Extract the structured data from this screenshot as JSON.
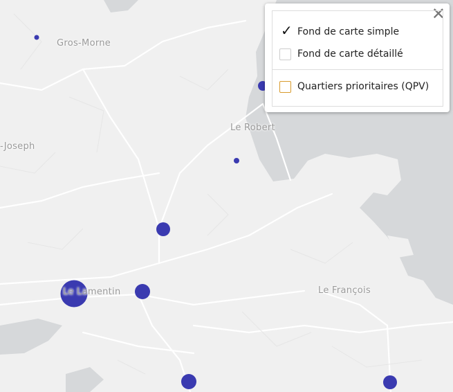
{
  "map": {
    "places": [
      {
        "id": "gros-morne",
        "label": "Gros-Morne"
      },
      {
        "id": "le-robert",
        "label": "Le Robert"
      },
      {
        "id": "saint-joseph",
        "label": "-Joseph"
      },
      {
        "id": "le-lamentin",
        "label": "Le Lamentin"
      },
      {
        "id": "le-francois",
        "label": "Le François"
      }
    ],
    "colors": {
      "land": "#f0f0f0",
      "water": "#d6d8da",
      "roads": "#ffffff",
      "markers": "#3a3ab0"
    }
  },
  "layer_control": {
    "close_icon": "close-icon",
    "basemap_simple": "Fond de carte simple",
    "basemap_simple_checked": "✓",
    "basemap_detailed": "Fond de carte détaillé",
    "qpv": "Quartiers prioritaires (QPV)"
  }
}
